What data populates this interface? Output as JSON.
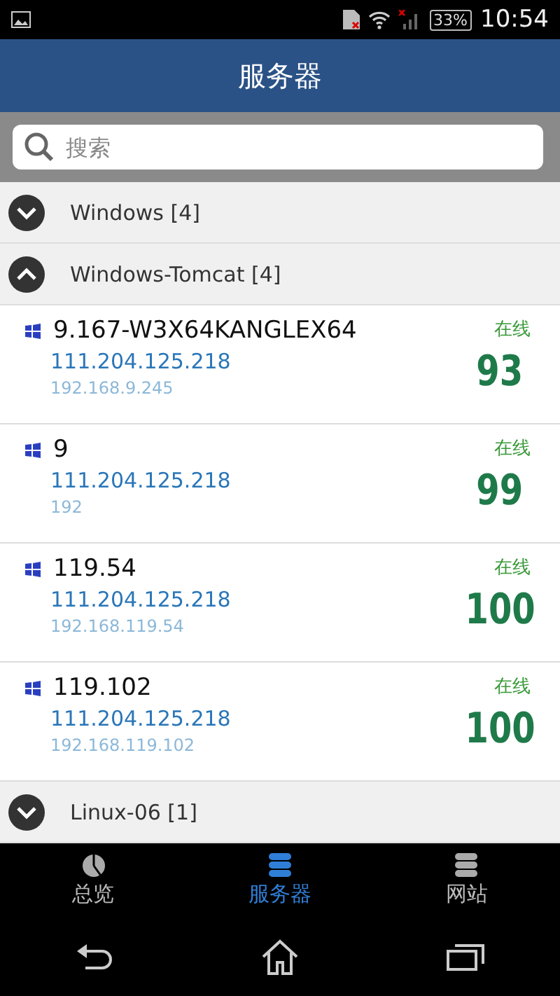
{
  "status_bar": {
    "battery": "33%",
    "time": "10:54"
  },
  "header": {
    "title": "服务器"
  },
  "search": {
    "placeholder": "搜索"
  },
  "groups": [
    {
      "name": "Windows [4]",
      "expanded": false
    },
    {
      "name": "Windows-Tomcat [4]",
      "expanded": true,
      "servers": [
        {
          "name": "9.167-W3X64KANGLEX64",
          "public_ip": "111.204.125.218",
          "lan_ip": "192.168.9.245",
          "status": "在线",
          "score": "93"
        },
        {
          "name": "9",
          "public_ip": "111.204.125.218",
          "lan_ip": "192",
          "status": "在线",
          "score": "99"
        },
        {
          "name": "119.54",
          "public_ip": "111.204.125.218",
          "lan_ip": "192.168.119.54",
          "status": "在线",
          "score": "100"
        },
        {
          "name": "119.102",
          "public_ip": "111.204.125.218",
          "lan_ip": "192.168.119.102",
          "status": "在线",
          "score": "100"
        }
      ]
    },
    {
      "name": "Linux-06 [1]",
      "expanded": false
    }
  ],
  "tabs": [
    {
      "label": "总览",
      "kind": "chart",
      "selected": false
    },
    {
      "label": "服务器",
      "kind": "server",
      "selected": true
    },
    {
      "label": "网站",
      "kind": "site",
      "selected": false
    }
  ]
}
